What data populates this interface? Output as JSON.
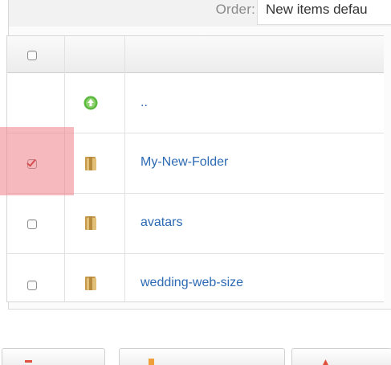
{
  "order": {
    "label": "Order:",
    "selected_value": "New items defau"
  },
  "table": {
    "header": {
      "select_all_checked": false,
      "icon_header": "",
      "name_header": ""
    },
    "parent": {
      "label": "..",
      "icon": "up-arrow-icon"
    },
    "rows": [
      {
        "label": "My-New-Folder",
        "icon": "folder-icon",
        "checked": true,
        "highlighted": true
      },
      {
        "label": "avatars",
        "icon": "folder-icon",
        "checked": false,
        "highlighted": false
      },
      {
        "label": "wedding-web-size",
        "icon": "folder-icon",
        "checked": false,
        "highlighted": false
      }
    ]
  },
  "colors": {
    "link": "#2c6ab3",
    "highlight": "#ef8087",
    "check_mark": "#b51212",
    "folder": "#d9b46a",
    "up_arrow": "#5cb940"
  },
  "bottom_buttons": [
    {
      "icon": "red-action-icon"
    },
    {
      "icon": "orange-action-icon"
    },
    {
      "icon": "red-action-icon"
    }
  ]
}
